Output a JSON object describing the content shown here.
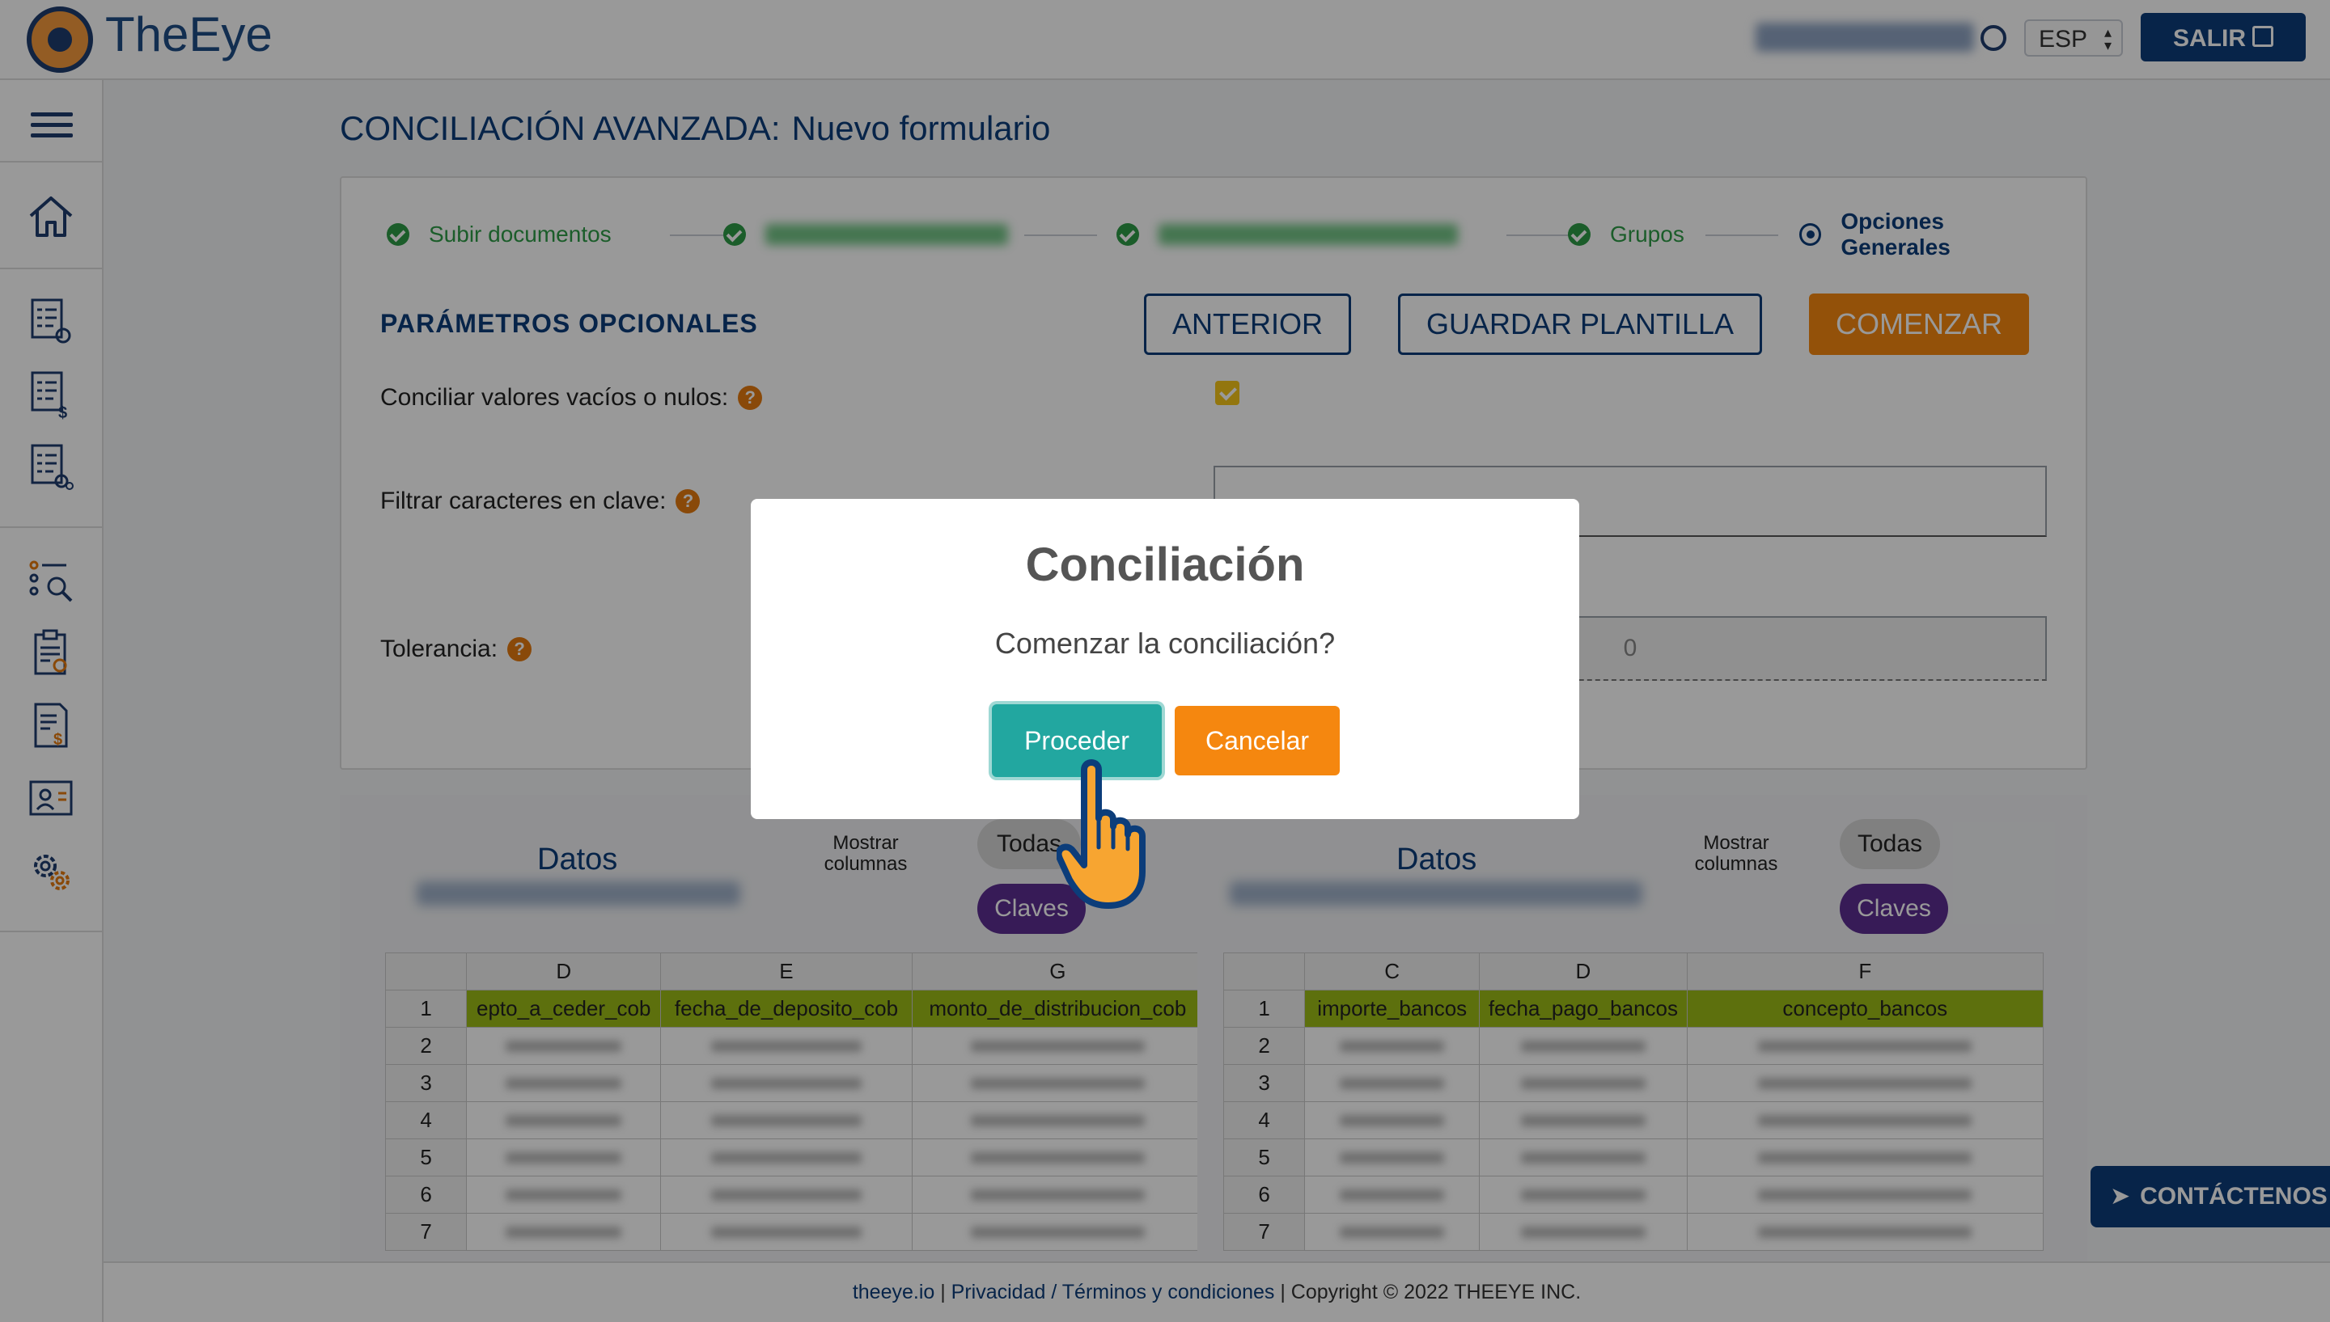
{
  "header": {
    "app_name": "TheEye",
    "language": "ESP",
    "logout_label": "SALIR"
  },
  "page": {
    "title": "CONCILIACIÓN AVANZADA:",
    "subtitle": "Nuevo formulario"
  },
  "stepper": {
    "steps": [
      {
        "label": "Subir documentos",
        "status": "done"
      },
      {
        "label": "",
        "status": "done"
      },
      {
        "label": "",
        "status": "done"
      },
      {
        "label": "Grupos",
        "status": "done"
      },
      {
        "label": "Opciones Generales",
        "status": "active"
      }
    ]
  },
  "params": {
    "section_title": "PARÁMETROS OPCIONALES",
    "prev_label": "ANTERIOR",
    "save_template_label": "GUARDAR PLANTILLA",
    "start_label": "COMENZAR",
    "empty_values_label": "Conciliar valores vacíos o nulos:",
    "empty_values_checked": true,
    "filter_chars_label": "Filtrar caracteres en clave:",
    "filter_chars_value": "",
    "tolerance_label": "Tolerancia:",
    "tolerance_value": "0",
    "help_glyph": "?"
  },
  "data_left": {
    "title": "Datos",
    "show_columns_label": "Mostrar columnas",
    "all_label": "Todas",
    "keys_label": "Claves",
    "columns": [
      "D",
      "E",
      "G"
    ],
    "headers": [
      "epto_a_ceder_cob",
      "fecha_de_deposito_cob",
      "monto_de_distribucion_cob"
    ],
    "rows": [
      "1",
      "2",
      "3",
      "4",
      "5",
      "6",
      "7"
    ]
  },
  "data_right": {
    "title": "Datos",
    "show_columns_label": "Mostrar columnas",
    "all_label": "Todas",
    "keys_label": "Claves",
    "columns": [
      "C",
      "D",
      "F"
    ],
    "headers": [
      "importe_bancos",
      "fecha_pago_bancos",
      "concepto_bancos"
    ],
    "rows": [
      "1",
      "2",
      "3",
      "4",
      "5",
      "6",
      "7"
    ]
  },
  "footer": {
    "site": "theeye.io",
    "sep1": " | ",
    "privacy": "Privacidad / Términos y condiciones",
    "copyright": " | Copyright © 2022 THEEYE INC."
  },
  "contact": {
    "label": "CONTÁCTENOS",
    "icon_glyph": "➤"
  },
  "dialog": {
    "title": "Conciliación",
    "message": "Comenzar la conciliación?",
    "proceed_label": "Proceder",
    "cancel_label": "Cancelar"
  },
  "colors": {
    "brand_blue": "#0c3d7a",
    "accent_orange": "#f5870f",
    "success_green": "#2e9b46",
    "teal": "#22a7a0",
    "purple": "#5c2d91",
    "header_green": "#9bbb17"
  },
  "icons": {
    "logo": "eye-logo-icon",
    "user": "user-circle-icon",
    "logout": "logout-icon",
    "menu": "hamburger-menu-icon",
    "home": "home-icon",
    "contact": "send-icon",
    "cursor": "hand-pointer-icon"
  }
}
